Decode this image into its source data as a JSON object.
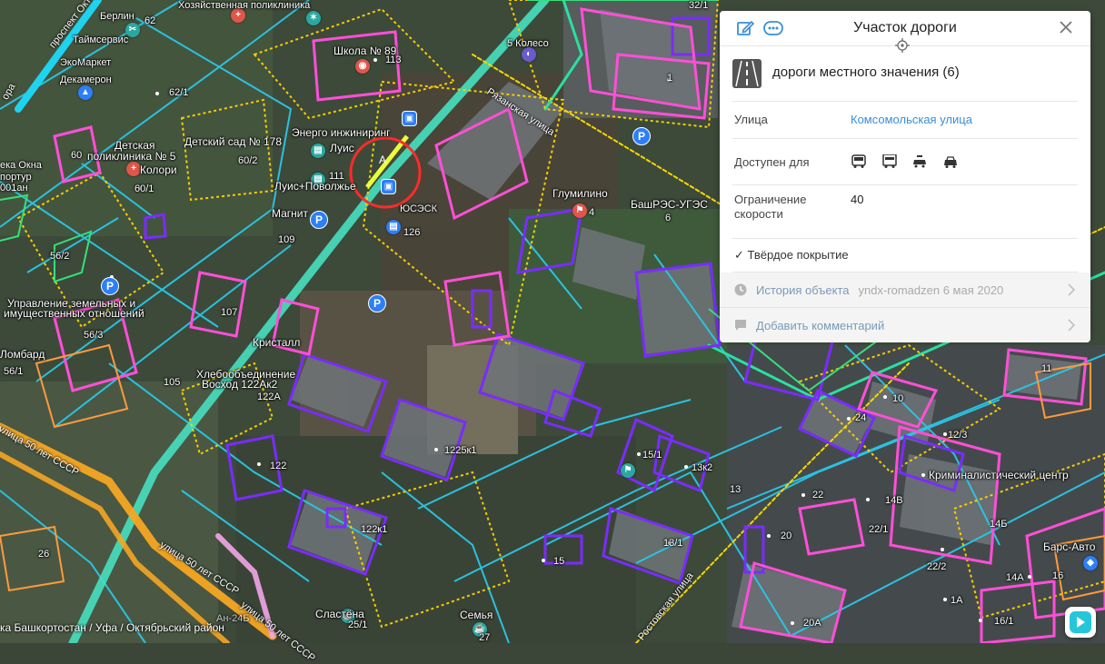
{
  "panel": {
    "title": "Участок дороги",
    "road_type": "дороги местного значения (6)",
    "street_label": "Улица",
    "street_value": "Комсомольская улица",
    "access_label": "Доступен для",
    "speed_label_1": "Ограничение",
    "speed_label_2": "скорости",
    "speed_value": "40",
    "surface": "✓ Твёрдое покрытие",
    "history_label": "История объекта",
    "history_meta": "yndx-romadzen 6 мая 2020",
    "comment_label": "Добавить комментарий",
    "icons": [
      "edit-icon",
      "more-icon",
      "close-icon",
      "road-icon",
      "bus-icon",
      "truck-icon",
      "taxi-icon",
      "car-icon",
      "clock-icon",
      "comment-icon"
    ]
  },
  "breadcrumb": "ка Башкортостан / Уфа / Октябрьский район",
  "map": {
    "marker_letter": "A",
    "accent_colors": {
      "road": "#46e0c0",
      "building_outline": "#7a2cff",
      "building_outline2": "#ff4fd8",
      "plot_outline": "#ffd400",
      "street_outline": "#29c8e8",
      "highlight": "#ff2b2b"
    },
    "labels": [
      {
        "text": "Берлин"
      },
      {
        "text": "62"
      },
      {
        "text": "Таймсервис"
      },
      {
        "text": "ЭкоМаркет"
      },
      {
        "text": "Декамерон"
      },
      {
        "text": "62/1"
      },
      {
        "text": "Школа № 89"
      },
      {
        "text": "113"
      },
      {
        "text": "5 Колесо"
      },
      {
        "text": "32/1"
      },
      {
        "text": "1"
      },
      {
        "text": "Детский сад № 178"
      },
      {
        "text": "60/2"
      },
      {
        "text": "Детская"
      },
      {
        "text": "поликлиника № 5"
      },
      {
        "text": "Колори"
      },
      {
        "text": "60"
      },
      {
        "text": "60/1"
      },
      {
        "text": "Энерго инжиниринг"
      },
      {
        "text": "Луис"
      },
      {
        "text": "111"
      },
      {
        "text": "Луис+Поволжье"
      },
      {
        "text": "Магнит"
      },
      {
        "text": "109"
      },
      {
        "text": "126"
      },
      {
        "text": "ЮСЭСК"
      },
      {
        "text": "Глумилино"
      },
      {
        "text": "4"
      },
      {
        "text": "БашРЭС-УГЭС"
      },
      {
        "text": "6"
      },
      {
        "text": "56/2"
      },
      {
        "text": "Управление земельных и"
      },
      {
        "text": "имущественных отношений"
      },
      {
        "text": "107"
      },
      {
        "text": "56/3"
      },
      {
        "text": "Кристалл"
      },
      {
        "text": "Ломбард"
      },
      {
        "text": "56/1"
      },
      {
        "text": "105"
      },
      {
        "text": "Хлебообъединение"
      },
      {
        "text": "Восход 122Ак2"
      },
      {
        "text": "122А"
      },
      {
        "text": "1225к1"
      },
      {
        "text": "122"
      },
      {
        "text": "122к1"
      },
      {
        "text": "15/1"
      },
      {
        "text": "13к2"
      },
      {
        "text": "13"
      },
      {
        "text": "10"
      },
      {
        "text": "24"
      },
      {
        "text": "11"
      },
      {
        "text": "12/3"
      },
      {
        "text": "Криминалистический центр"
      },
      {
        "text": "14В"
      },
      {
        "text": "22"
      },
      {
        "text": "22/1"
      },
      {
        "text": "20"
      },
      {
        "text": "14Б"
      },
      {
        "text": "22/2"
      },
      {
        "text": "14А"
      },
      {
        "text": "16"
      },
      {
        "text": "Барс-Авто"
      },
      {
        "text": "13/1"
      },
      {
        "text": "15"
      },
      {
        "text": "26"
      },
      {
        "text": "Сластёна"
      },
      {
        "text": "25/1"
      },
      {
        "text": "Семья"
      },
      {
        "text": "27"
      },
      {
        "text": "20А"
      },
      {
        "text": "16/1"
      },
      {
        "text": "1А"
      },
      {
        "text": "Ан-24Б"
      },
      {
        "text": "Хозяйственная поликлиника"
      },
      {
        "text": "ека Окна"
      },
      {
        "text": "портур"
      },
      {
        "text": "001ан"
      },
      {
        "text": "Рязанская улица"
      },
      {
        "text": "проспект Октября"
      },
      {
        "text": "Ростовская улица"
      },
      {
        "text": "улица 50 лет СССР"
      },
      {
        "text": "улица 50 лет СССР"
      },
      {
        "text": "улица 50 лет СССР"
      },
      {
        "text": "ора"
      }
    ]
  }
}
